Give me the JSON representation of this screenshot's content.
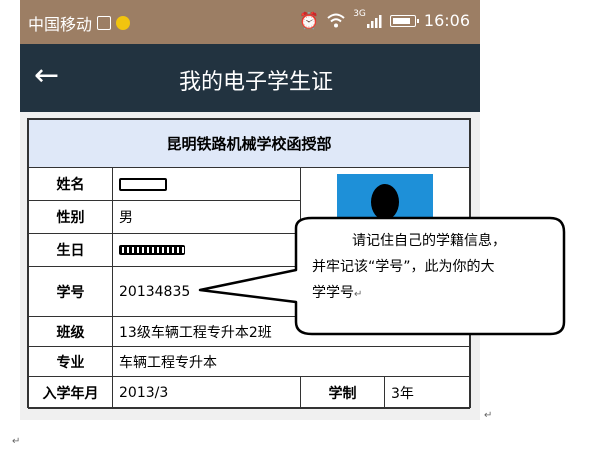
{
  "status_bar": {
    "carrier": "中国移动",
    "network": "3G",
    "time": "16:06"
  },
  "app_bar": {
    "back_glyph": "←",
    "title": "我的电子学生证"
  },
  "card": {
    "school": "昆明铁路机械学校函授部",
    "rows": [
      {
        "label": "姓名",
        "value": ""
      },
      {
        "label": "性别",
        "value": "男"
      },
      {
        "label": "生日",
        "value": ""
      },
      {
        "label": "学号",
        "value": "20134835"
      },
      {
        "label": "班级",
        "value": "13级车辆工程专升本2班"
      },
      {
        "label": "专业",
        "value": "车辆工程专升本"
      }
    ],
    "enroll_label": "入学年月",
    "enroll_value": "2013/3",
    "duration_label": "学制",
    "duration_value": "3年"
  },
  "callout": {
    "line1": "请记住自己的学籍信息，",
    "line2": "并牢记该“学号”，此为你的大",
    "line3": "学学号"
  },
  "colors": {
    "status_bar": "#9c7e64",
    "app_bar": "#223340",
    "header_row": "#dfe8f8",
    "photo_bg": "#1e90d8"
  }
}
